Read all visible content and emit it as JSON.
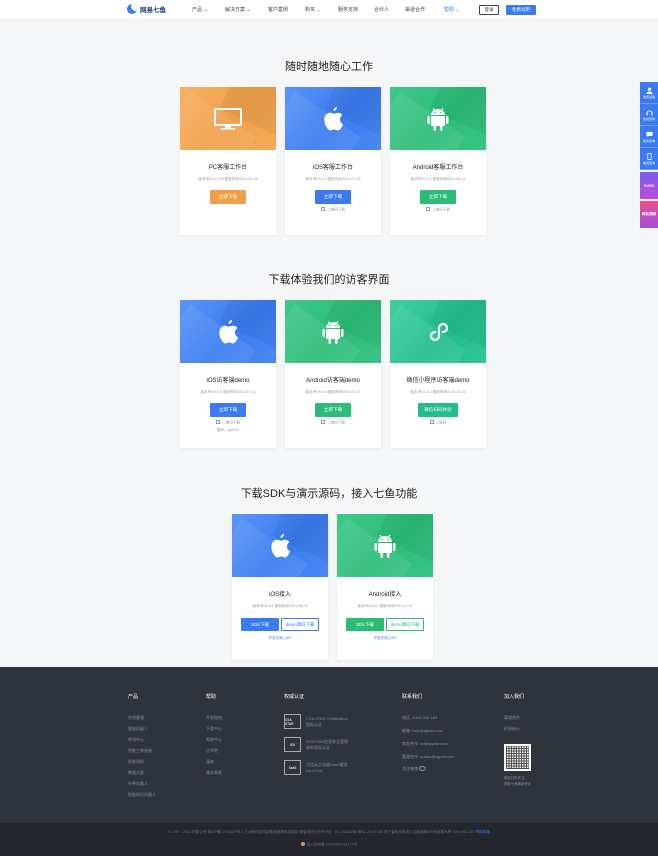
{
  "nav": {
    "logo_text": "网易七鱼",
    "menu": [
      "产品",
      "解决方案",
      "客户案例",
      "购买",
      "服务支持",
      "合伙人",
      "渠道合作",
      "帮助"
    ],
    "login": "登录",
    "trial": "免费试用"
  },
  "section1": {
    "title": "随时随地随心工作",
    "cards": [
      {
        "title": "PC客服工作台",
        "meta": "版本号V4.2.230 更新时间2021-06-28",
        "button": "立即下载"
      },
      {
        "title": "iOS客服工作台",
        "meta": "版本号V4.2.0 更新时间2021-07-15",
        "button": "立即下载",
        "qr": "二维码下载"
      },
      {
        "title": "Android客服工作台",
        "meta": "版本号V4.2.1 更新时间2021-08-11",
        "button": "立即下载",
        "qr": "二维码下载"
      }
    ]
  },
  "section2": {
    "title": "下载体验我们的访客界面",
    "cards": [
      {
        "title": "iOS访客端demo",
        "meta": "版本号V6.0.0 更新时间2021-07-13",
        "button": "立即下载",
        "qr": "二维码下载",
        "sub": "密码：qy2022"
      },
      {
        "title": "Android访客端demo",
        "meta": "版本号V6.0.0 更新时间2021-07-13",
        "button": "立即下载",
        "qr": "二维码下载"
      },
      {
        "title": "微信小程序访客端demo",
        "meta": "版本号V1.0.2 更新时间2019-10-15",
        "button": "微信扫码体验",
        "qr": "二维码"
      }
    ]
  },
  "section3": {
    "title": "下载SDK与演示源码，接入七鱼功能",
    "cards": [
      {
        "title": "iOS接入",
        "meta": "版本号V6.6.1 更新时间2021-08-06",
        "sdk": "SDK下载",
        "demo": "demo源码下载",
        "links": "开发手册 | API"
      },
      {
        "title": "Android接入",
        "meta": "版本号V6.6.0 更新时间2021-07-13",
        "sdk": "SDK下载",
        "demo": "demo源码下载",
        "links": "开发手册 | API"
      }
    ]
  },
  "float_bar": [
    "免费试用",
    "在线咨询",
    "留言咨询",
    "电话咨询",
    "¥1000",
    "有奖调研"
  ],
  "footer": {
    "products": {
      "head": "产品",
      "items": [
        "在线客服",
        "智能机器人",
        "呼叫中心",
        "智能工单系统",
        "智能质检",
        "数据大屏",
        "外呼机器人",
        "智能知识机器人"
      ]
    },
    "help": {
      "head": "帮助",
      "items": [
        "开发指南",
        "下载中心",
        "帮助中心",
        "红学院",
        "媒体",
        "服务条款"
      ]
    },
    "certs": {
      "head": "权威认证",
      "items": [
        {
          "badge": "CSA STAR",
          "line1": "CSA STAR Certification",
          "line2": "国际认证"
        },
        {
          "badge": "ISO",
          "line1": "ISO27001信息安全管理",
          "line2": "体系国际认证"
        },
        {
          "badge": "SaaS",
          "line1": "可信云企业级SaaS服务",
          "line2": "No.07040"
        }
      ]
    },
    "contact": {
      "head": "联系我们",
      "items": [
        "电话: 4009-000-163",
        "邮箱: help@qiyukf.com",
        "商务合作: bd@qiyukf.com",
        "渠道合作: qudao@qiyukf.com",
        "关注微博"
      ]
    },
    "join": {
      "head": "加入我们",
      "items": [
        "渠道合作",
        "招贤纳士"
      ],
      "qr_caption1": "微信扫码关注",
      "qr_caption2": "获取七鱼最新资讯"
    },
    "copyright": "© 1997 - 2021 网易公司  浙ICP备17034647号-1  工业和信息化部备案管理系统网站  增值电信业务许可证：B1-20180288 浙B2-20150160  浙江省杭州市滨江区网商路599号网易大厦  4009-000-163",
    "report": "举报邮箱",
    "police": "浙公网安备 33010802012177号"
  }
}
